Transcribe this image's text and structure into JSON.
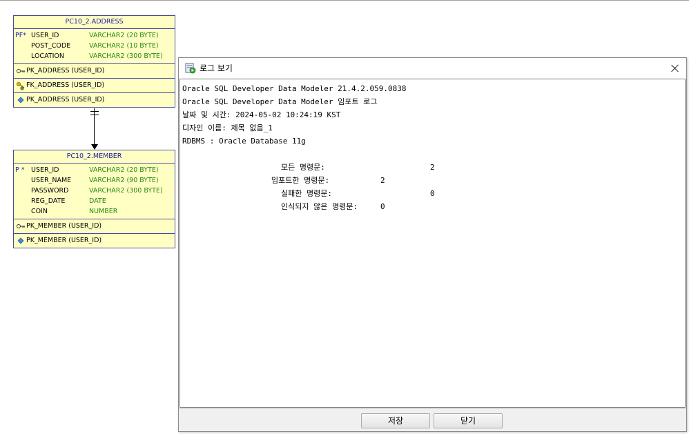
{
  "address_table": {
    "title": "PC10_2.ADDRESS",
    "columns": [
      {
        "flag": "PF*",
        "name": "USER_ID",
        "type": "VARCHAR2 (20 BYTE)"
      },
      {
        "flag": "",
        "name": "POST_CODE",
        "type": "VARCHAR2 (10 BYTE)"
      },
      {
        "flag": "",
        "name": "LOCATION",
        "type": "VARCHAR2 (300 BYTE)"
      }
    ],
    "pk": "PK_ADDRESS (USER_ID)",
    "fk": "FK_ADDRESS (USER_ID)",
    "index": "PK_ADDRESS (USER_ID)"
  },
  "member_table": {
    "title": "PC10_2.MEMBER",
    "columns": [
      {
        "flag": "P  *",
        "name": "USER_ID",
        "type": "VARCHAR2 (20 BYTE)"
      },
      {
        "flag": "",
        "name": "USER_NAME",
        "type": "VARCHAR2 (90 BYTE)"
      },
      {
        "flag": "",
        "name": "PASSWORD",
        "type": "VARCHAR2 (300 BYTE)"
      },
      {
        "flag": "",
        "name": "REG_DATE",
        "type": "DATE"
      },
      {
        "flag": "",
        "name": "COIN",
        "type": "NUMBER"
      }
    ],
    "pk": "PK_MEMBER (USER_ID)",
    "index": "PK_MEMBER (USER_ID)"
  },
  "dialog": {
    "title": "로그 보기",
    "log_lines": [
      "Oracle SQL Developer Data Modeler 21.4.2.059.0838",
      "Oracle SQL Developer Data Modeler 임포트 로그",
      "날짜 및 시간: 2024-05-02 10:24:19 KST",
      "디자인 이름: 제목 없음_1",
      "RDBMS : Oracle Database 11g"
    ],
    "stats": [
      {
        "label": "모든 명령문:",
        "value": "2"
      },
      {
        "label": "임포트한 명령문:",
        "value": "2"
      },
      {
        "label": "실패한 명령문:",
        "value": "0"
      },
      {
        "label": "인식되지 않은 명령문:",
        "value": "0"
      }
    ],
    "save_label": "저장",
    "close_label": "닫기"
  }
}
